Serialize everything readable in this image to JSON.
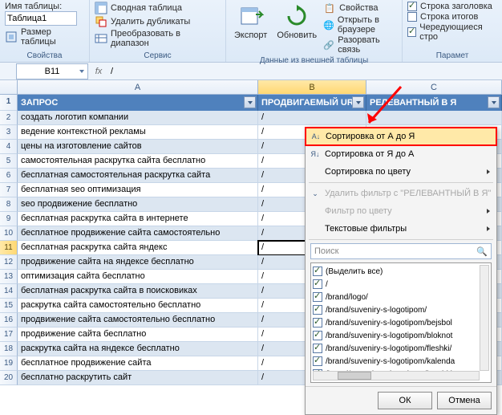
{
  "ribbon": {
    "table_name_label": "Имя таблицы:",
    "table_name_value": "Таблица1",
    "resize_table": "Размер таблицы",
    "group_props": "Свойства",
    "pivot_table": "Сводная таблица",
    "remove_dups": "Удалить дубликаты",
    "convert_range": "Преобразовать в диапазон",
    "group_service": "Сервис",
    "export": "Экспорт",
    "refresh": "Обновить",
    "props": "Свойства",
    "open_browser": "Открыть в браузере",
    "unlink": "Разорвать связь",
    "group_external": "Данные из внешней таблицы",
    "header_row": "Строка заголовка",
    "totals_row": "Строка итогов",
    "banded_rows": "Чередующиеся стро",
    "group_params": "Парамет"
  },
  "formula_bar": {
    "cell_ref": "B11",
    "fx": "fx",
    "value": "/"
  },
  "columns": {
    "A": "A",
    "B": "B",
    "C": "C"
  },
  "headers": {
    "A": "ЗАПРОС",
    "B": "ПРОДВИГАЕМЫЙ URL",
    "C": "РЕЛЕВАНТНЫЙ В Я"
  },
  "rows": [
    {
      "n": 2,
      "a": "создать логотип компании",
      "b": "/"
    },
    {
      "n": 3,
      "a": "ведение контекстной рекламы",
      "b": "/"
    },
    {
      "n": 4,
      "a": "цены на изготовление сайтов",
      "b": "/"
    },
    {
      "n": 5,
      "a": "самостоятельная раскрутка сайта бесплатно",
      "b": "/"
    },
    {
      "n": 6,
      "a": "бесплатная самостоятельная раскрутка сайта",
      "b": "/"
    },
    {
      "n": 7,
      "a": "бесплатная seo оптимизация",
      "b": "/"
    },
    {
      "n": 8,
      "a": "seo продвижение бесплатно",
      "b": "/"
    },
    {
      "n": 9,
      "a": "бесплатная раскрутка сайта в интернете",
      "b": "/"
    },
    {
      "n": 10,
      "a": "бесплатное продвижение сайта самостоятельно",
      "b": "/"
    },
    {
      "n": 11,
      "a": "бесплатная раскрутка сайта яндекс",
      "b": "/"
    },
    {
      "n": 12,
      "a": "продвижение сайта на яндексе бесплатно",
      "b": "/"
    },
    {
      "n": 13,
      "a": "оптимизация сайта бесплатно",
      "b": "/"
    },
    {
      "n": 14,
      "a": "бесплатная раскрутка сайта в поисковиках",
      "b": "/"
    },
    {
      "n": 15,
      "a": "раскрутка сайта самостоятельно бесплатно",
      "b": "/"
    },
    {
      "n": 16,
      "a": "продвижение сайта самостоятельно бесплатно",
      "b": "/"
    },
    {
      "n": 17,
      "a": "продвижение сайта бесплатно",
      "b": "/"
    },
    {
      "n": 18,
      "a": "раскрутка сайта на яндексе бесплатно",
      "b": "/"
    },
    {
      "n": 19,
      "a": "бесплатное продвижение сайта",
      "b": "/"
    },
    {
      "n": 20,
      "a": "бесплатно раскрутить сайт",
      "b": "/"
    }
  ],
  "filter": {
    "sort_az": "Сортировка от А до Я",
    "sort_za": "Сортировка от Я до А",
    "sort_color": "Сортировка по цвету",
    "clear_filter": "Удалить фильтр с \"РЕЛЕВАНТНЫЙ В Я\"",
    "filter_color": "Фильтр по цвету",
    "text_filters": "Текстовые фильтры",
    "search_placeholder": "Поиск",
    "select_all": "(Выделить все)",
    "items": [
      "/",
      "/brand/logo/",
      "/brand/suveniry-s-logotipom/",
      "/brand/suveniry-s-logotipom/bejsbol",
      "/brand/suveniry-s-logotipom/bloknot",
      "/brand/suveniry-s-logotipom/fleshki/",
      "/brand/suveniry-s-logotipom/kalenda",
      "/brand/suveniry-s-logotipom/kruzhki,"
    ],
    "ok": "ОК",
    "cancel": "Отмена"
  }
}
